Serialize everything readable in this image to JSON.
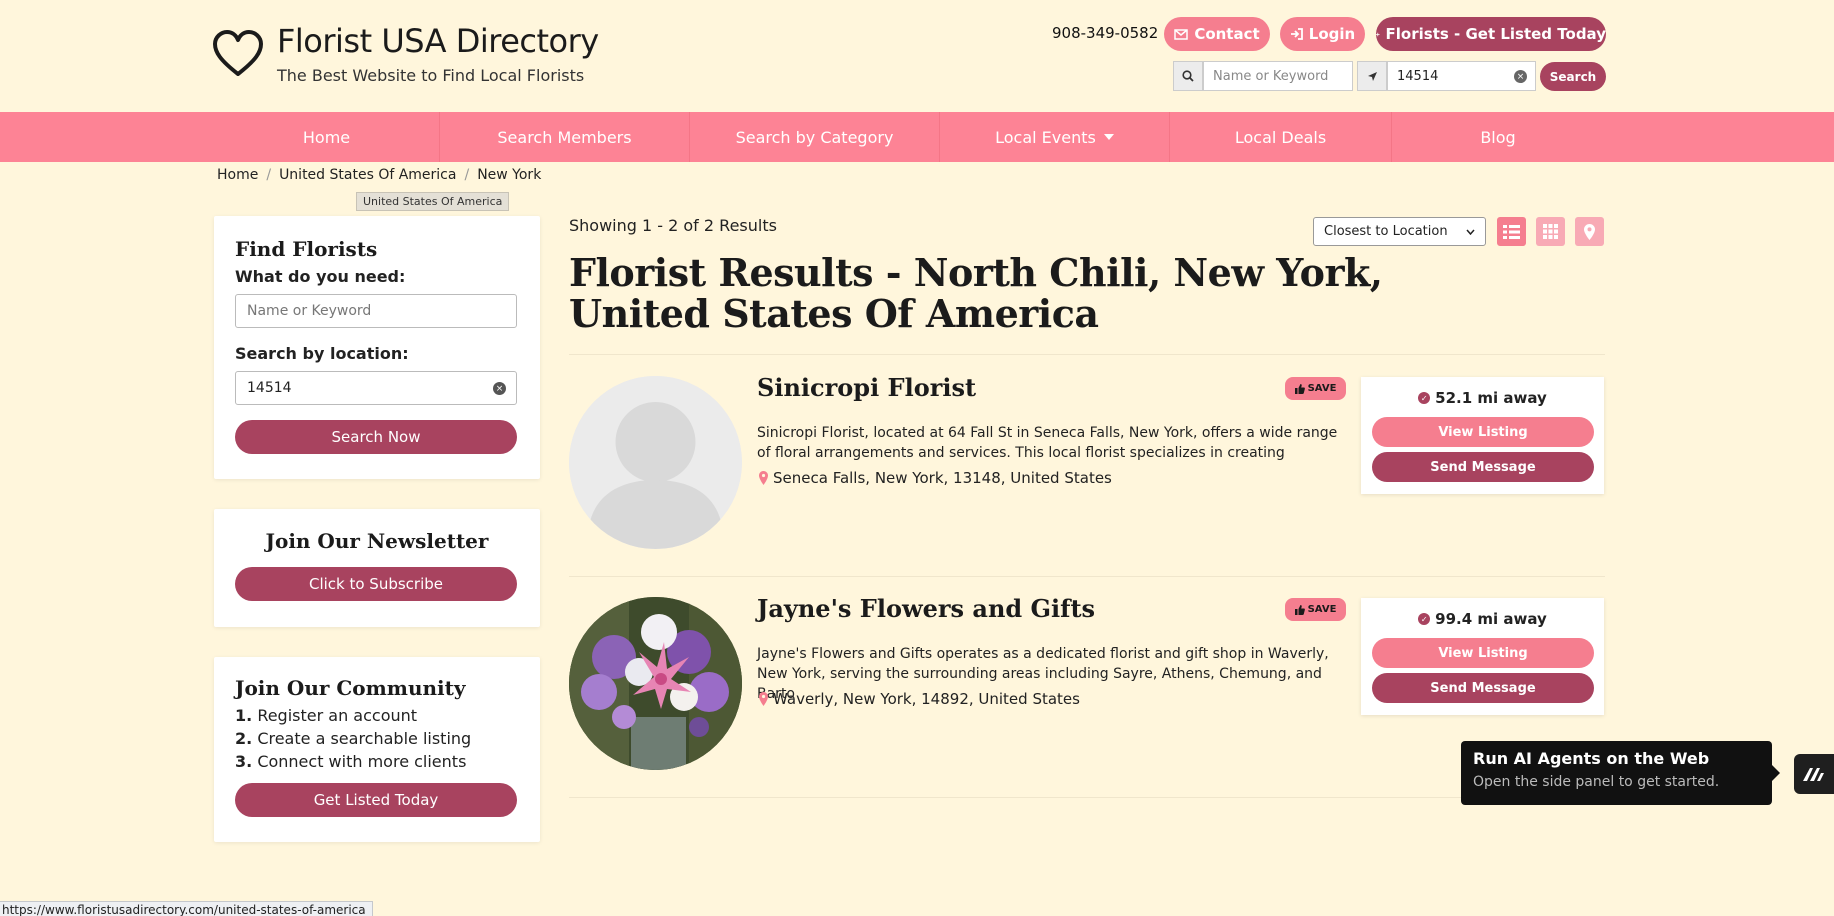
{
  "header": {
    "site_title": "Florist USA Directory",
    "tagline": "The Best Website to Find Local Florists",
    "phone": "908-349-0582",
    "contact_label": "Contact",
    "login_label": "Login",
    "get_listed_label": "Florists - Get Listed Today",
    "search_keyword_placeholder": "Name or Keyword",
    "search_location_value": "14514",
    "search_button_label": "Search"
  },
  "nav": {
    "items": [
      {
        "label": "Home"
      },
      {
        "label": "Search Members"
      },
      {
        "label": "Search by Category"
      },
      {
        "label": "Local Events"
      },
      {
        "label": "Local Deals"
      },
      {
        "label": "Blog"
      }
    ]
  },
  "breadcrumb": {
    "items": [
      "Home",
      "United States Of America",
      "New York"
    ],
    "tooltip": "United States Of America"
  },
  "sidebar": {
    "find": {
      "title": "Find Florists",
      "need_label": "What do you need:",
      "keyword_placeholder": "Name or Keyword",
      "location_label": "Search by location:",
      "location_value": "14514",
      "button_label": "Search Now"
    },
    "newsletter": {
      "title": "Join Our Newsletter",
      "button_label": "Click to Subscribe"
    },
    "community": {
      "title": "Join Our Community",
      "steps": [
        {
          "num": "1.",
          "text": "Register an account"
        },
        {
          "num": "2.",
          "text": "Create a searchable listing"
        },
        {
          "num": "3.",
          "text": "Connect with more clients"
        }
      ],
      "button_label": "Get Listed Today"
    }
  },
  "results": {
    "showing_text": "Showing 1 - 2 of 2 Results",
    "sort_selected": "Closest to Location",
    "title": "Florist Results - North Chili, New York, United States Of America",
    "listings": [
      {
        "name": "Sinicropi Florist",
        "save_label": "SAVE",
        "description": "Sinicropi Florist, located at 64 Fall St in Seneca Falls, New York, offers a wide range of floral arrangements and services. This local florist specializes in creating",
        "address": "Seneca Falls, New York, 13148, United States",
        "distance": "52.1 mi away",
        "view_label": "View Listing",
        "message_label": "Send Message"
      },
      {
        "name": "Jayne's Flowers and Gifts",
        "save_label": "SAVE",
        "description": "Jayne's Flowers and Gifts operates as a dedicated florist and gift shop in Waverly, New York, serving the surrounding areas including Sayre, Athens, Chemung, and Barto",
        "address": "Waverly, New York, 14892, United States",
        "distance": "99.4 mi away",
        "view_label": "View Listing",
        "message_label": "Send Message"
      }
    ]
  },
  "ai_popup": {
    "title": "Run AI Agents on the Web",
    "subtitle": "Open the side panel to get started."
  },
  "status_bar": {
    "url": "https://www.floristusadirectory.com/united-states-of-america"
  },
  "colors": {
    "background": "#fff6dc",
    "nav_pink": "#fd8395",
    "button_pink": "#f57e8f",
    "button_dark": "#a8435f"
  },
  "icons": [
    "heart-logo-icon",
    "envelope-icon",
    "login-icon",
    "plus-icon",
    "search-icon",
    "location-arrow-icon",
    "clear-icon",
    "caret-down-icon",
    "list-view-icon",
    "grid-view-icon",
    "map-pin-icon",
    "thumbs-up-icon",
    "check-circle-icon",
    "ai-agent-icon"
  ]
}
